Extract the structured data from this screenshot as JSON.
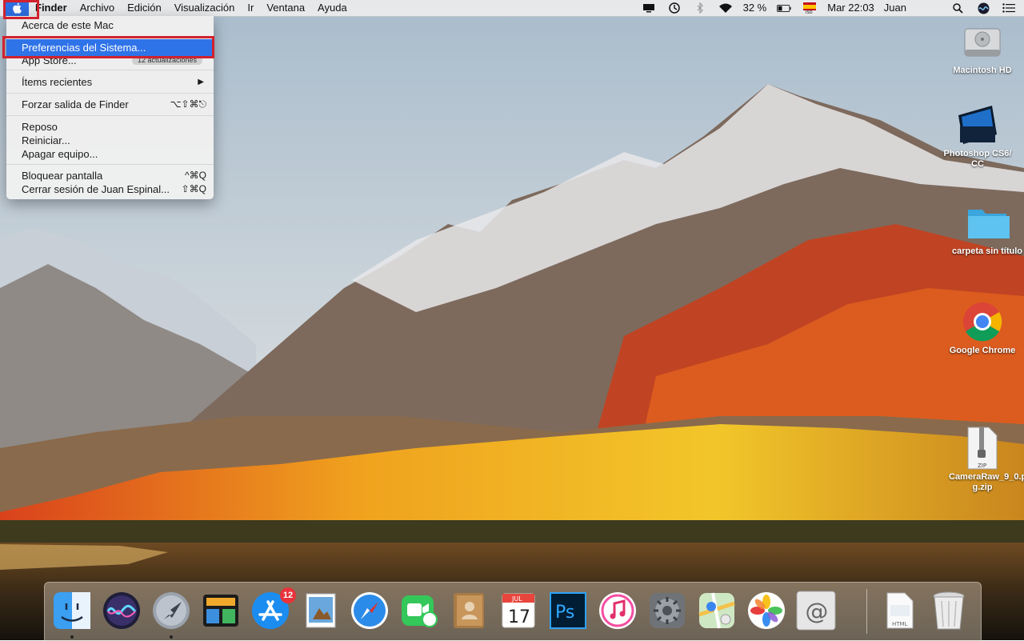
{
  "menubar": {
    "apple_icon": "apple-logo-icon",
    "app_name": "Finder",
    "menus": [
      "Archivo",
      "Edición",
      "Visualización",
      "Ir",
      "Ventana",
      "Ayuda"
    ],
    "status_icons": [
      "display-icon",
      "time-machine-icon",
      "bluetooth-icon",
      "wifi-icon"
    ],
    "battery_percent": "32 %",
    "input_flag": "spain-flag-icon",
    "clock": "Mar 22:03",
    "user": "Juan",
    "right_icons": [
      "spotlight-search-icon",
      "siri-icon",
      "notification-center-icon"
    ]
  },
  "apple_menu": {
    "items": [
      {
        "label": "Acerca de este Mac"
      },
      {
        "label": "Preferencias del Sistema..."
      },
      {
        "label": "App Store...",
        "badge": "12 actualizaciones"
      },
      {
        "label": "Ítems recientes"
      },
      {
        "label": "Forzar salida de Finder",
        "shortcut": "⌥⇧⌘⎋"
      },
      {
        "label": "Reposo"
      },
      {
        "label": "Reiniciar..."
      },
      {
        "label": "Apagar equipo..."
      },
      {
        "label": "Bloquear pantalla",
        "shortcut": "^⌘Q"
      },
      {
        "label": "Cerrar sesión de Juan Espinal...",
        "shortcut": "⇧⌘Q"
      }
    ]
  },
  "desktop_icons": [
    {
      "label": "Macintosh HD",
      "icon": "hard-drive-icon"
    },
    {
      "label": "Photoshop CS6/ CC",
      "icon": "photoshop-folder-icon"
    },
    {
      "label": "carpeta sin título",
      "icon": "folder-icon"
    },
    {
      "label": "Google Chrome",
      "icon": "chrome-icon"
    },
    {
      "label": "CameraRaw_9_0.p g.zip",
      "icon": "zip-file-icon"
    }
  ],
  "dock": {
    "apps": [
      "finder-icon",
      "siri-icon",
      "launchpad-icon",
      "mission-control-icon",
      "app-store-icon",
      "preview-icon",
      "safari-icon",
      "facetime-icon",
      "contacts-icon",
      "calendar-icon",
      "photoshop-icon",
      "itunes-icon",
      "system-preferences-icon",
      "maps-icon",
      "photos-icon",
      "mail-icon",
      "html-document-icon",
      "trash-icon"
    ],
    "app_store_badge": "12",
    "calendar_month": "JUL",
    "calendar_day": "17",
    "photoshop_text": "Ps"
  }
}
